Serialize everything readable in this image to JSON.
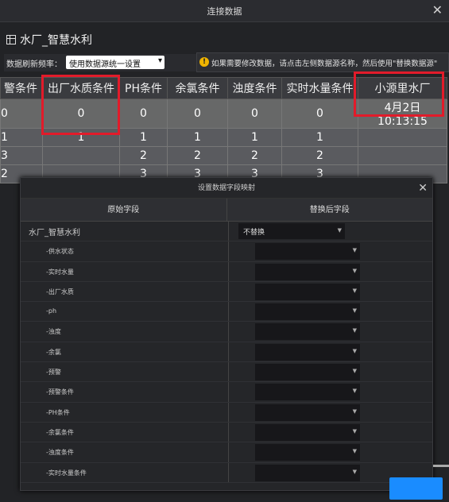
{
  "window": {
    "title": "连接数据",
    "close_icon": "close-icon"
  },
  "datasource": {
    "title": "水厂_智慧水利"
  },
  "refresh": {
    "label": "数据刷新频率：",
    "value": "使用数据源统一设置"
  },
  "hint": {
    "text": "如果需要修改数据，请点击左侧数据源名称，然后使用\"替换数据源\""
  },
  "table": {
    "headers": [
      "警条件",
      "出厂水质条件",
      "PH条件",
      "余氯条件",
      "浊度条件",
      "实时水量条件",
      "小源里水厂"
    ],
    "rows": [
      [
        "0",
        "0",
        "0",
        "0",
        "0",
        "0",
        "4月2日 10:13:15"
      ],
      [
        "1",
        "1",
        "1",
        "1",
        "1",
        "1",
        ""
      ],
      [
        "3",
        "",
        "2",
        "2",
        "2",
        "2",
        ""
      ],
      [
        "2",
        "",
        "3",
        "3",
        "3",
        "3",
        ""
      ]
    ]
  },
  "mapping": {
    "title": "设置数据字段映射",
    "col_original": "原始字段",
    "col_replaced": "替换后字段",
    "root": {
      "label": "水厂_智慧水利",
      "value": "不替换"
    },
    "fields": [
      "-供水状态",
      "-实时水量",
      "-出厂水质",
      "-ph",
      "-浊度",
      "-余氯",
      "-预警",
      "-预警条件",
      "-PH条件",
      "-余氯条件",
      "-浊度条件",
      "-实时水量条件"
    ]
  },
  "colors": {
    "highlight": "#e21b2a",
    "accent": "#1a8cff"
  }
}
